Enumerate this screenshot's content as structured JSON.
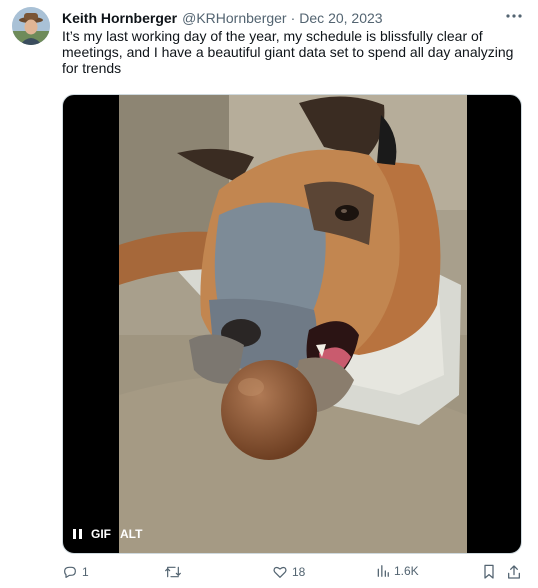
{
  "tweet": {
    "author_name": "Keith Hornberger",
    "author_handle": "@KRHornberger",
    "separator": "·",
    "date": "Dec 20, 2023",
    "text": "It’s my last working day of the year, my schedule is blissfully clear of meetings, and I have a beautiful giant data set to spend all day analyzing for trends",
    "more_icon": "more-horizontal-icon"
  },
  "media": {
    "type": "gif",
    "gif_label": "GIF",
    "alt_label": "ALT",
    "pause_icon": "pause-icon"
  },
  "actions": {
    "reply_count": "1",
    "retweet_count": "",
    "like_count": "18",
    "view_count": "1.6K",
    "reply_icon": "reply-icon",
    "retweet_icon": "retweet-icon",
    "like_icon": "heart-icon",
    "views_icon": "views-chart-icon",
    "bookmark_icon": "bookmark-icon",
    "share_icon": "share-icon"
  },
  "colors": {
    "text_primary": "#0f1419",
    "text_secondary": "#536471",
    "media_background": "#000000",
    "border": "#cfd9de"
  }
}
